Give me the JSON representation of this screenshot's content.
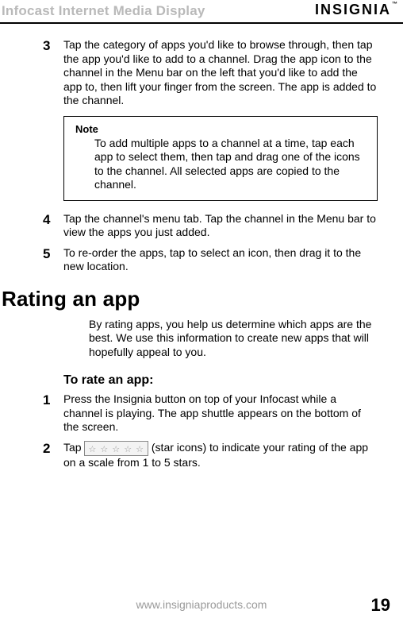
{
  "header": {
    "title": "Infocast Internet Media Display",
    "brand": "INSIGNIA",
    "brand_tm": "™"
  },
  "steps_top": [
    {
      "num": "3",
      "text": "Tap the category of apps you'd like to browse through, then tap the app you'd like to add to a channel. Drag the app icon to the channel in the Menu bar on the left that you'd like to add the app to, then lift your finger from the screen. The app is added to the channel."
    }
  ],
  "note": {
    "label": "Note",
    "body": "To add multiple apps to a channel at a time, tap each app to select them, then tap and drag one of the icons to the channel. All selected apps are copied to the channel."
  },
  "steps_mid": [
    {
      "num": "4",
      "text": "Tap the channel's menu tab. Tap the channel in the Menu bar to view the apps you just added."
    },
    {
      "num": "5",
      "text": "To re-order the apps, tap to select an icon, then drag it to the new location."
    }
  ],
  "section": {
    "h1": "Rating an app",
    "intro": "By rating apps, you help us determine which apps are the best. We use this information to create new apps that will hopefully appeal to you.",
    "h2": "To rate an app:",
    "steps": [
      {
        "num": "1",
        "text": "Press the Insignia button on top of your Infocast while a channel is playing. The app shuttle appears on the bottom of the screen."
      },
      {
        "num": "2",
        "text_pre": "Tap ",
        "text_post": " (star icons) to indicate your rating of the app on a scale from 1 to 5 stars.",
        "stars": "☆ ☆ ☆ ☆ ☆"
      }
    ]
  },
  "footer": {
    "url": "www.insigniaproducts.com",
    "page": "19"
  }
}
